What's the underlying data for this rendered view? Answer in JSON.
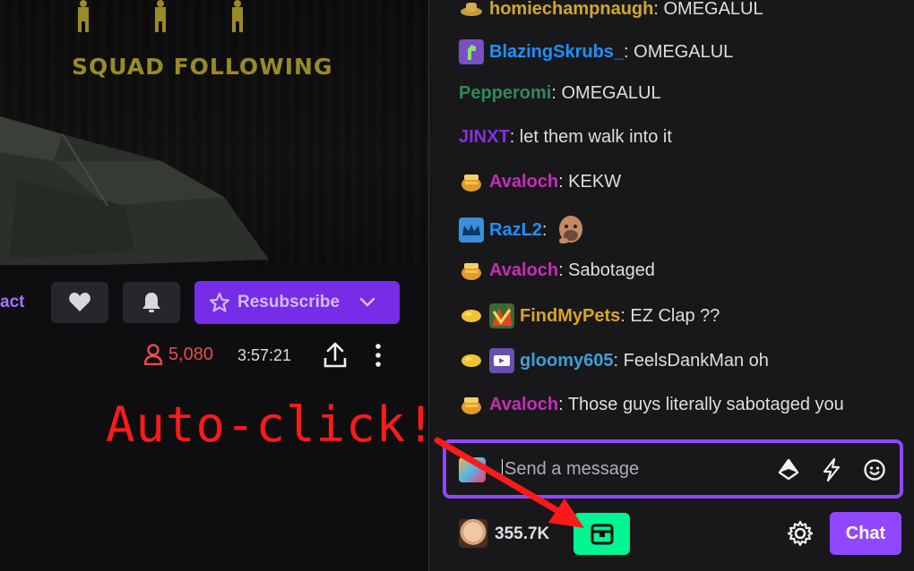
{
  "video": {
    "overlay_text": "SQUAD FOLLOWING"
  },
  "channel_bar": {
    "contact_partial": "act",
    "follow_icon": "heart-icon",
    "notify_icon": "bell-icon",
    "resubscribe_label": "Resubscribe",
    "viewer_count": "5,080",
    "uptime": "3:57:21"
  },
  "chat": {
    "messages": [
      {
        "user": "homiechampnaugh",
        "text": ": OMEGALUL",
        "color": "#d4a62a",
        "badge": "hat-badge"
      },
      {
        "user": "BlazingSkrubs_",
        "text": ": OMEGALUL",
        "color": "#1e90ff",
        "badge": "dino-badge"
      },
      {
        "user": "Pepperomi",
        "text": ": OMEGALUL",
        "color": "#2e8b57",
        "badge": ""
      },
      {
        "user": "JINXT",
        "text": ": let them walk into it",
        "color": "#8a2be2",
        "badge": ""
      },
      {
        "user": "Avaloch",
        "text": ": KEKW",
        "color": "#c62db5",
        "badge": "honey-pot-badge"
      },
      {
        "user": "RazL2",
        "text": ":",
        "color": "#1e90ff",
        "badge": "crown-badge"
      },
      {
        "user": "Avaloch",
        "text": ": Sabotaged",
        "color": "#c62db5",
        "badge": "honey-pot-badge"
      },
      {
        "user": "FindMyPets",
        "text": ": EZ Clap ??",
        "color": "#daa520",
        "badge": "lemon-badge"
      },
      {
        "user": "gloomy605",
        "text": ": FeelsDankMan oh",
        "color": "#3aa0d8",
        "badge": "lemon-badge"
      },
      {
        "user": "Avaloch",
        "text": ": Those guys literally sabotaged you",
        "color": "#c62db5",
        "badge": "honey-pot-badge"
      }
    ],
    "input_placeholder": "Send a message",
    "points_balance": "355.7K",
    "chat_button": "Chat"
  },
  "annotation": {
    "label": "Auto-click!",
    "color": "#ff1a1a"
  }
}
